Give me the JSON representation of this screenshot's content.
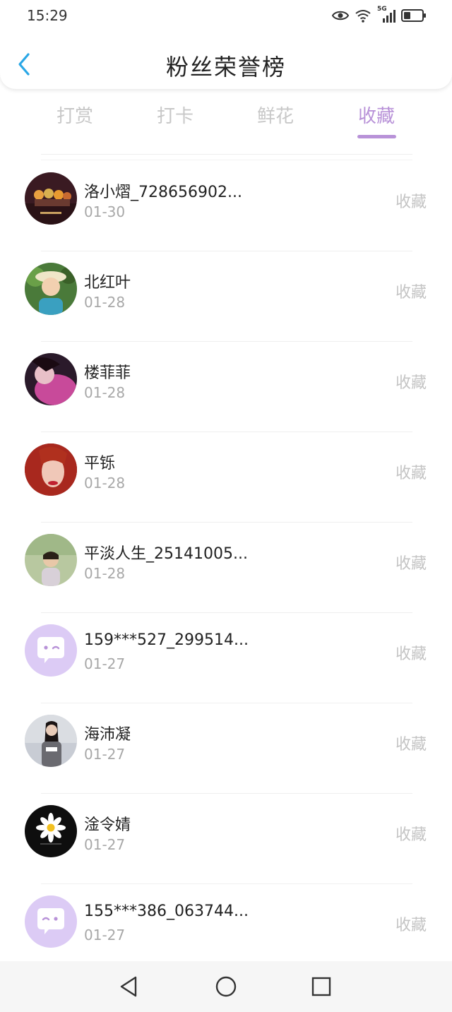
{
  "status_bar": {
    "time": "15:29",
    "network": "5G",
    "icons": [
      "eye-icon",
      "wifi-icon",
      "signal-icon",
      "battery-icon"
    ]
  },
  "header": {
    "title": "粉丝荣誉榜",
    "back_icon": "chevron-left-icon"
  },
  "tabs": [
    {
      "label": "打赏",
      "active": false
    },
    {
      "label": "打卡",
      "active": false
    },
    {
      "label": "鲜花",
      "active": false
    },
    {
      "label": "收藏",
      "active": true
    }
  ],
  "list": {
    "items": [
      {
        "name": "洛小熠_728656902...",
        "date": "01-30",
        "action": "收藏",
        "avatar": "photo-avatar"
      },
      {
        "name": "北红叶",
        "date": "01-28",
        "action": "收藏",
        "avatar": "photo-avatar"
      },
      {
        "name": "楼菲菲",
        "date": "01-28",
        "action": "收藏",
        "avatar": "photo-avatar"
      },
      {
        "name": "平铄",
        "date": "01-28",
        "action": "收藏",
        "avatar": "photo-avatar"
      },
      {
        "name": "平淡人生_25141005...",
        "date": "01-28",
        "action": "收藏",
        "avatar": "photo-avatar"
      },
      {
        "name": "159***527_299514...",
        "date": "01-27",
        "action": "收藏",
        "avatar": "default-chat-avatar"
      },
      {
        "name": "海沛凝",
        "date": "01-27",
        "action": "收藏",
        "avatar": "photo-avatar"
      },
      {
        "name": "淦令婧",
        "date": "01-27",
        "action": "收藏",
        "avatar": "daisy-avatar"
      },
      {
        "name": "155***386_063744...",
        "date": "01-27",
        "action": "收藏",
        "avatar": "default-chat-avatar"
      }
    ]
  },
  "nav_bar": {
    "buttons": [
      "back-triangle-icon",
      "home-circle-icon",
      "recents-square-icon"
    ]
  },
  "colors": {
    "accent": "#b892d8",
    "back_icon": "#2aa7e6",
    "muted_text": "#c4c4c4",
    "date_text": "#a8a8a8",
    "default_avatar_bg": "#dccbf5"
  }
}
